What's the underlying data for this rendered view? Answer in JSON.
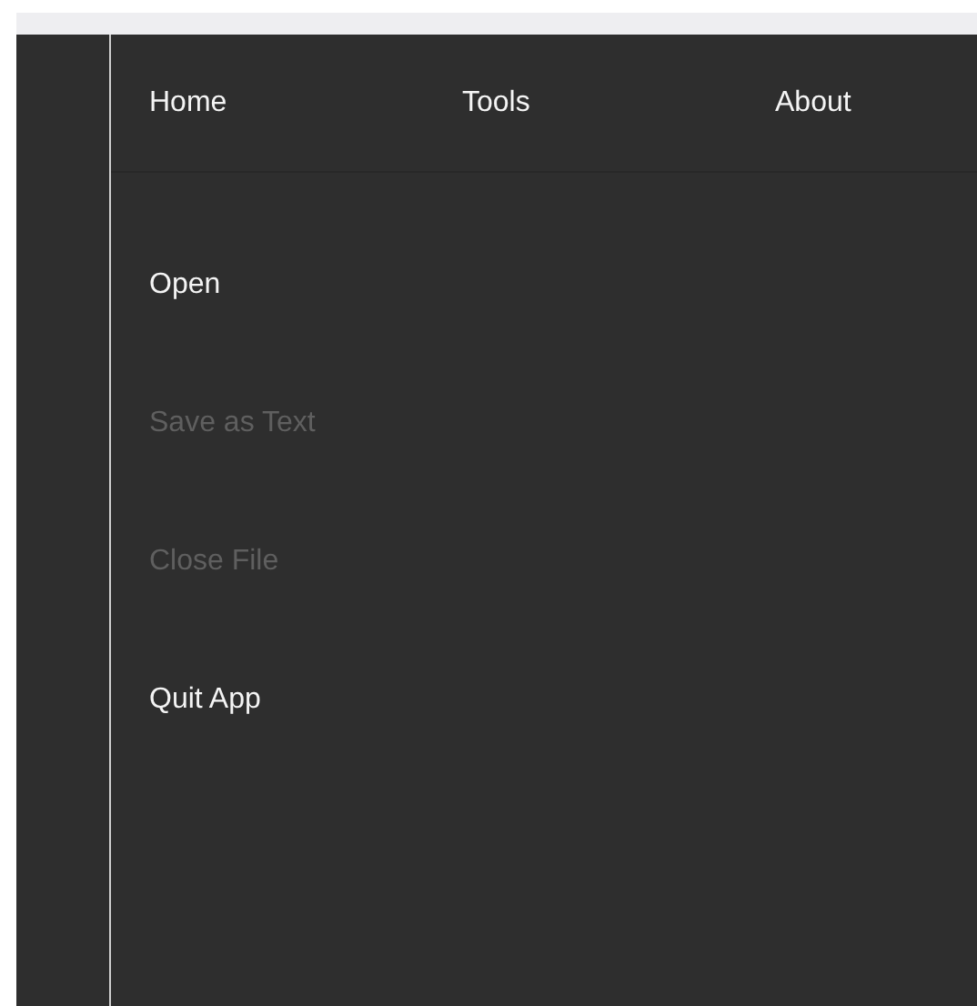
{
  "nav": [
    {
      "label": "Home"
    },
    {
      "label": "Tools"
    },
    {
      "label": "About"
    }
  ],
  "menu": [
    {
      "label": "Open",
      "disabled": false
    },
    {
      "label": "Save as Text",
      "disabled": true
    },
    {
      "label": "Close File",
      "disabled": true
    },
    {
      "label": "Quit App",
      "disabled": false
    }
  ]
}
